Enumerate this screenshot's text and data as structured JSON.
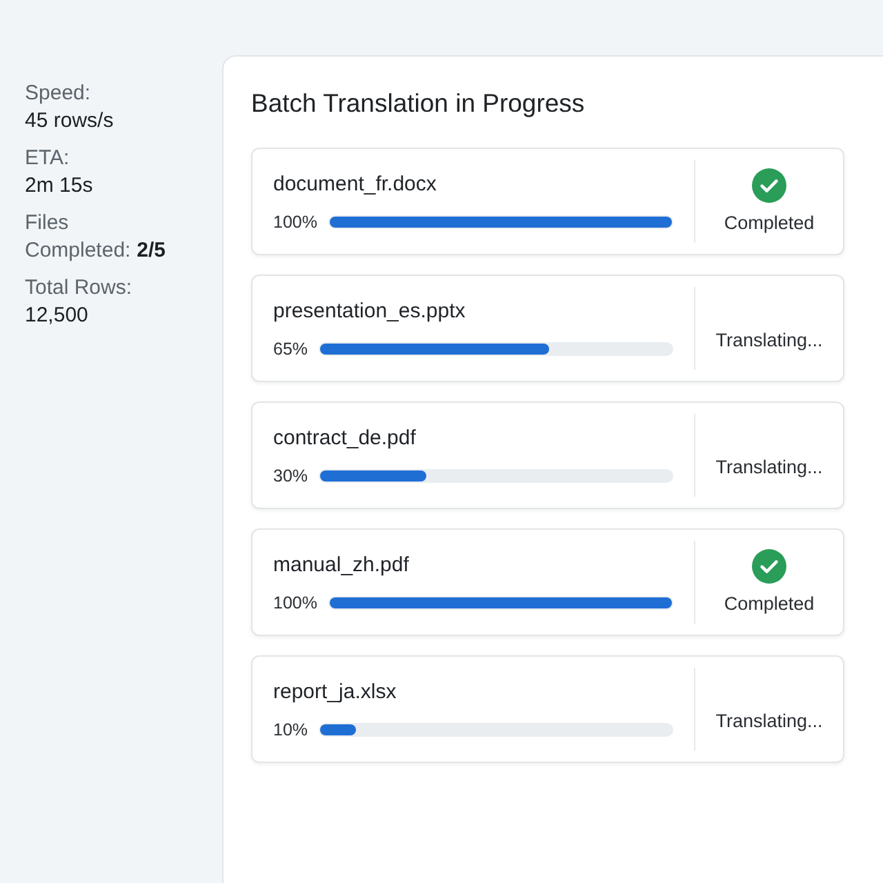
{
  "stats": [
    {
      "kind": "stacked",
      "label": "Speed:",
      "value": "45 rows/s"
    },
    {
      "kind": "stacked",
      "label": "ETA:",
      "value": "2m 15s"
    },
    {
      "kind": "inline",
      "label": "Files Completed:",
      "value": "2/5"
    },
    {
      "kind": "stacked",
      "label": "Total Rows:",
      "value": "12,500"
    }
  ],
  "panel": {
    "title": "Batch Translation in Progress",
    "files": [
      {
        "name": "document_fr.docx",
        "percent": "100%",
        "level": 1,
        "status": {
          "kind": "completed",
          "label": "Completed"
        }
      },
      {
        "name": "presentation_es.pptx",
        "percent": "65%",
        "level": 0.65,
        "status": {
          "kind": "translating",
          "label": "Translating..."
        }
      },
      {
        "name": "contract_de.pdf",
        "percent": "30%",
        "level": 0.3,
        "status": {
          "kind": "translating",
          "label": "Translating..."
        }
      },
      {
        "name": "manual_zh.pdf",
        "percent": "100%",
        "level": 1,
        "status": {
          "kind": "completed",
          "label": "Completed"
        }
      },
      {
        "name": "report_ja.xlsx",
        "percent": "10%",
        "level": 0.1,
        "status": {
          "kind": "translating",
          "label": "Translating..."
        }
      }
    ]
  }
}
